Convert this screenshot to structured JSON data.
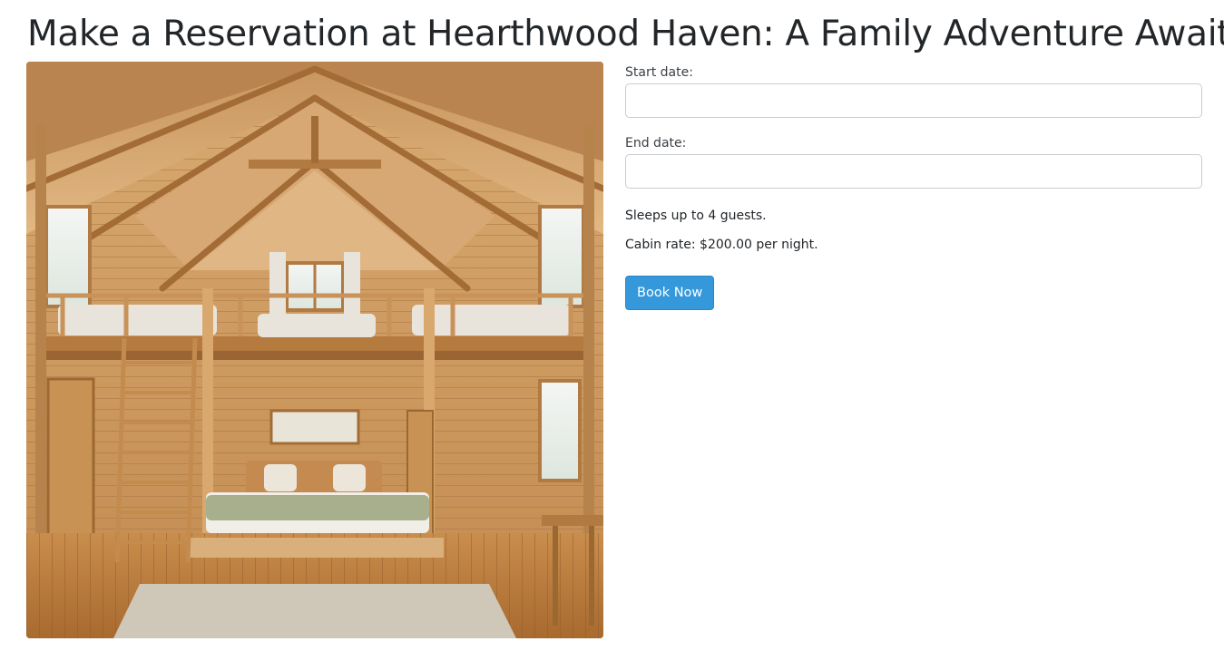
{
  "page": {
    "title": "Make a Reservation at Hearthwood Haven: A Family Adventure Awaits"
  },
  "image": {
    "icon": "cabin-interior-photo"
  },
  "form": {
    "start_date_label": "Start date:",
    "start_date_value": "",
    "end_date_label": "End date:",
    "end_date_value": "",
    "capacity_text": "Sleeps up to 4 guests.",
    "rate_text": "Cabin rate: $200.00 per night.",
    "book_button": "Book Now"
  },
  "colors": {
    "accent": "#3498db",
    "text": "#212529",
    "input_border": "#c9ccd0"
  }
}
